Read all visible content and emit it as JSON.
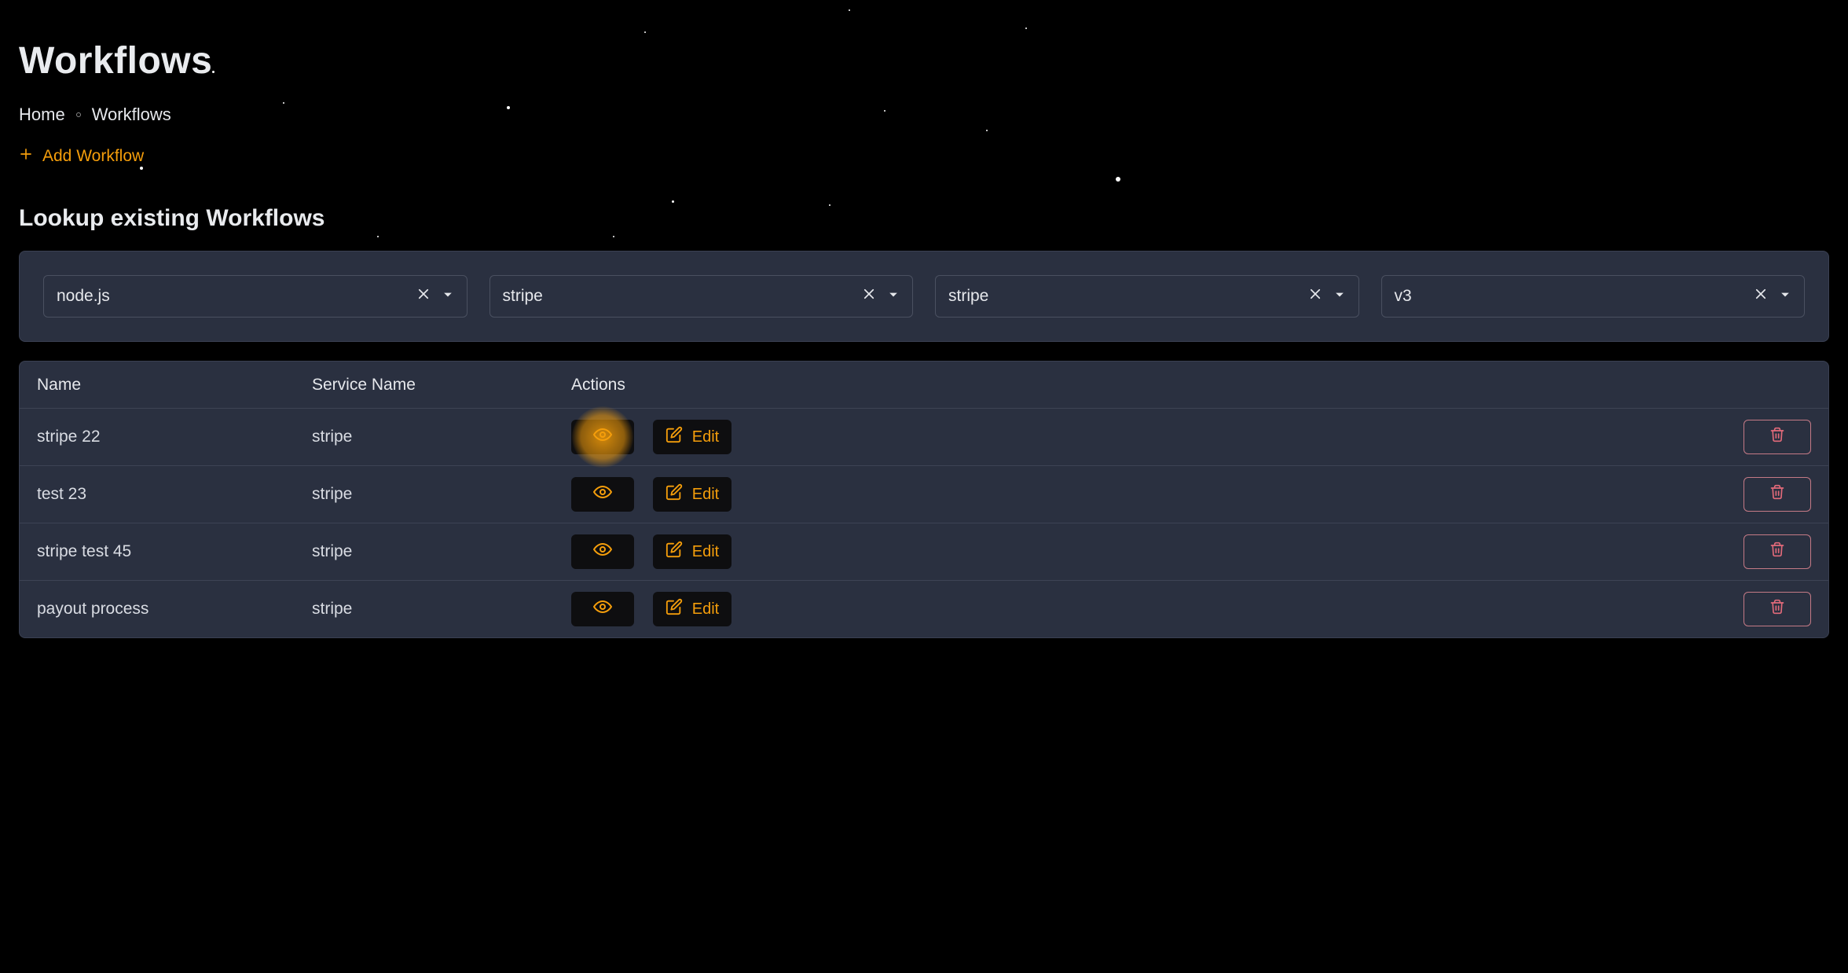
{
  "page_title": "Workflows",
  "breadcrumb": {
    "home": "Home",
    "current": "Workflows"
  },
  "add_link": "Add Workflow",
  "section_title": "Lookup existing Workflows",
  "filters": [
    {
      "value": "node.js"
    },
    {
      "value": "stripe"
    },
    {
      "value": "stripe"
    },
    {
      "value": "v3"
    }
  ],
  "table": {
    "headers": {
      "name": "Name",
      "service": "Service Name",
      "actions": "Actions"
    },
    "edit_label": "Edit",
    "rows": [
      {
        "name": "stripe 22",
        "service": "stripe"
      },
      {
        "name": "test 23",
        "service": "stripe"
      },
      {
        "name": "stripe test 45",
        "service": "stripe"
      },
      {
        "name": "payout process",
        "service": "stripe"
      }
    ]
  }
}
